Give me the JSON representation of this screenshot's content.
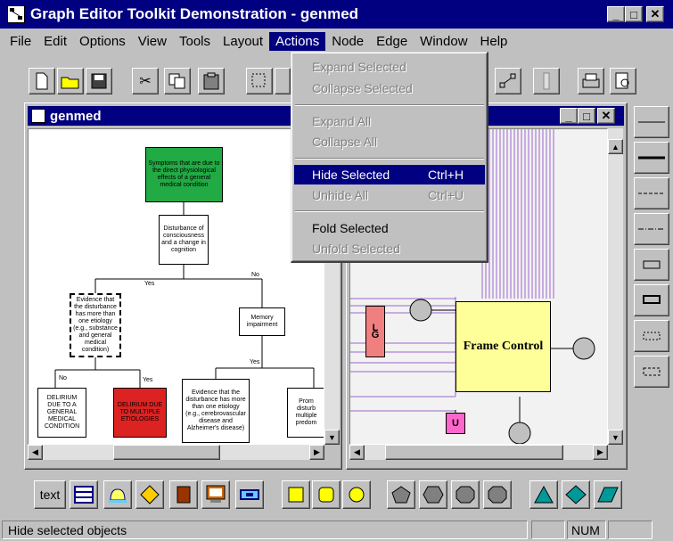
{
  "window": {
    "title": "Graph Editor Toolkit Demonstration - genmed"
  },
  "menu": [
    "File",
    "Edit",
    "Options",
    "View",
    "Tools",
    "Layout",
    "Actions",
    "Node",
    "Edge",
    "Window",
    "Help"
  ],
  "actions_menu": [
    {
      "label": "Expand Selected",
      "shortcut": "",
      "enabled": false
    },
    {
      "label": "Collapse Selected",
      "shortcut": "",
      "enabled": false
    },
    {
      "label": "Expand All",
      "shortcut": "",
      "enabled": false
    },
    {
      "label": "Collapse All",
      "shortcut": "",
      "enabled": false
    },
    {
      "label": "Hide Selected",
      "shortcut": "Ctrl+H",
      "enabled": true,
      "highlighted": true
    },
    {
      "label": "Unhide All",
      "shortcut": "Ctrl+U",
      "enabled": false
    },
    {
      "label": "Fold Selected",
      "shortcut": "",
      "enabled": true
    },
    {
      "label": "Unfold Selected",
      "shortcut": "",
      "enabled": false
    }
  ],
  "left_doc": {
    "title": "genmed",
    "nodes": {
      "top": "Symptoms that are due to the direct physiological effects of a general medical condition",
      "disturbance": "Disturbance of consciousness and a change in cognition",
      "evidence1": "Evidence that the disturbance has more than one etiology (e.g., substance and general medical condition)",
      "memory": "Memory impairment",
      "delirium_gmc": "DELIRIUM DUE TO A GENERAL MEDICAL CONDITION",
      "delirium_multi": "DELIRIUM DUE TO MULTIPLE ETIOLOGIES",
      "evidence2": "Evidence that the disturbance has more than one etiology (e.g., cerebrovascular disease and Alzheimer's disease)",
      "prom": "Prom disturb multiple predom"
    },
    "edge_labels": {
      "no1": "No",
      "yes1": "Yes",
      "no2": "No",
      "yes2": "Yes",
      "yes3": "Yes"
    }
  },
  "right_doc": {
    "nodes": {
      "lg": "L G",
      "frame": "Frame Control",
      "u": "U"
    }
  },
  "palette": {
    "text_tool": "text"
  },
  "status": {
    "message": "Hide selected objects",
    "num": "NUM"
  },
  "colors": {
    "title_bar": "#000080",
    "green_node": "#22aa44",
    "red_node": "#dd2222",
    "frame_node": "#ffff99",
    "lg_node": "#f08080",
    "u_node": "#ff66cc",
    "edge_purple": "#9966cc"
  }
}
